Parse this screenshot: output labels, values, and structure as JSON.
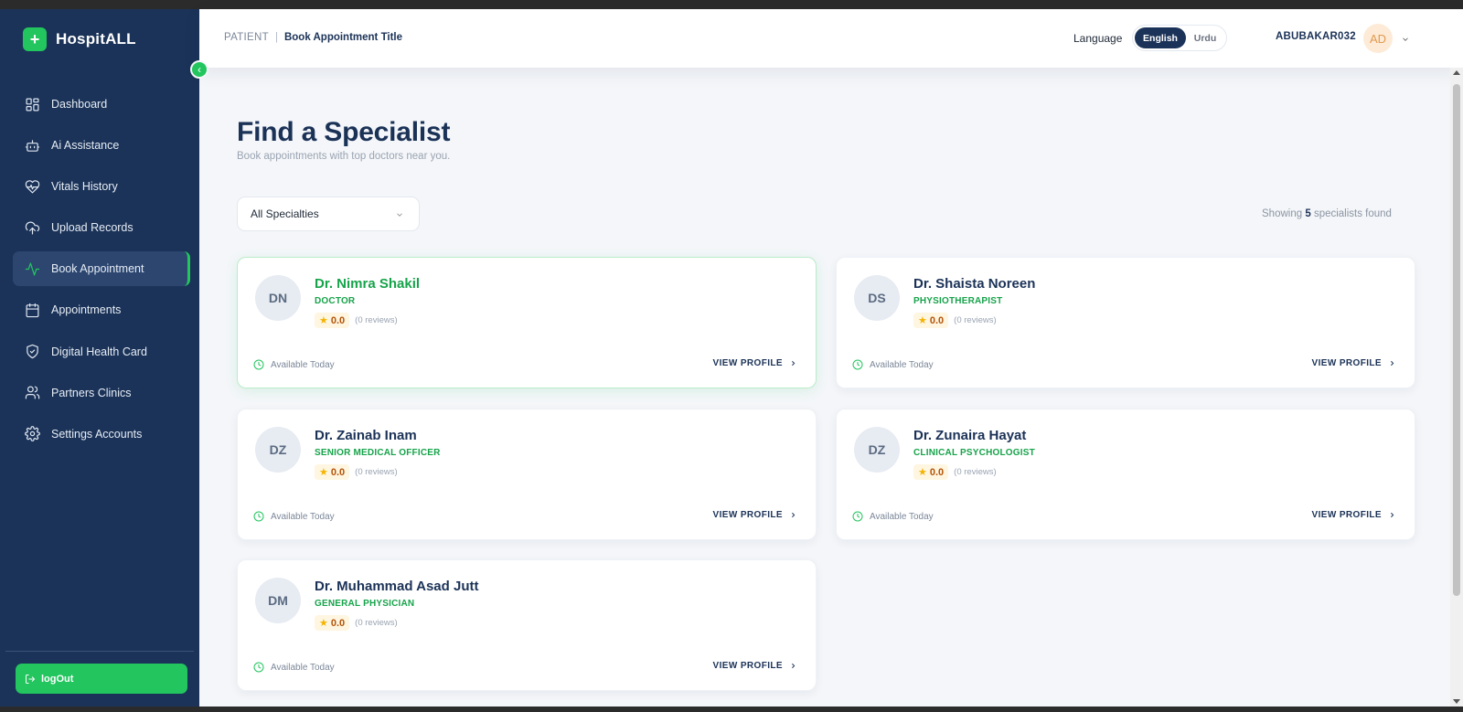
{
  "brand": {
    "name": "HospitALL",
    "logo_symbol": "+"
  },
  "sidebar": {
    "items": [
      {
        "label": "Dashboard",
        "icon": "dashboard-grid-icon"
      },
      {
        "label": "Ai Assistance",
        "icon": "robot-icon"
      },
      {
        "label": "Vitals History",
        "icon": "heart-pulse-icon"
      },
      {
        "label": "Upload Records",
        "icon": "cloud-upload-icon"
      },
      {
        "label": "Book Appointment",
        "icon": "activity-icon",
        "active": true
      },
      {
        "label": "Appointments",
        "icon": "calendar-icon"
      },
      {
        "label": "Digital Health Card",
        "icon": "shield-check-icon"
      },
      {
        "label": "Partners Clinics",
        "icon": "users-icon"
      },
      {
        "label": "Settings Accounts",
        "icon": "gear-icon"
      }
    ],
    "logout_label": "logOut"
  },
  "header": {
    "breadcrumb_root": "PATIENT",
    "breadcrumb_sep": "|",
    "breadcrumb_current": "Book Appointment Title",
    "language_label": "Language",
    "language_options": [
      "English",
      "Urdu"
    ],
    "language_selected": "English",
    "username": "ABUBAKAR032",
    "avatar_initials": "AD"
  },
  "main": {
    "title": "Find a Specialist",
    "subtitle": "Book appointments with top doctors near you.",
    "specialty_filter": "All Specialties",
    "results_prefix": "Showing",
    "results_count": "5",
    "results_suffix": "specialists found"
  },
  "doctors": [
    {
      "initials": "DN",
      "name": "Dr. Nimra Shakil",
      "specialty": "DOCTOR",
      "rating": "0.0",
      "reviews": "(0 reviews)",
      "availability": "Available Today",
      "cta": "VIEW PROFILE"
    },
    {
      "initials": "DS",
      "name": "Dr. Shaista Noreen",
      "specialty": "PHYSIOTHERAPIST",
      "rating": "0.0",
      "reviews": "(0 reviews)",
      "availability": "Available Today",
      "cta": "VIEW PROFILE"
    },
    {
      "initials": "DZ",
      "name": "Dr. Zainab Inam",
      "specialty": "SENIOR MEDICAL OFFICER",
      "rating": "0.0",
      "reviews": "(0 reviews)",
      "availability": "Available Today",
      "cta": "VIEW PROFILE"
    },
    {
      "initials": "DZ",
      "name": "Dr. Zunaira Hayat",
      "specialty": "CLINICAL PSYCHOLOGIST",
      "rating": "0.0",
      "reviews": "(0 reviews)",
      "availability": "Available Today",
      "cta": "VIEW PROFILE"
    },
    {
      "initials": "DM",
      "name": "Dr. Muhammad Asad Jutt",
      "specialty": "GENERAL PHYSICIAN",
      "rating": "0.0",
      "reviews": "(0 reviews)",
      "availability": "Available Today",
      "cta": "VIEW PROFILE"
    }
  ],
  "colors": {
    "sidebar_bg": "#1b3358",
    "accent_green": "#22c55e",
    "navy_text": "#1b3257",
    "page_bg": "#f4f6f9"
  }
}
